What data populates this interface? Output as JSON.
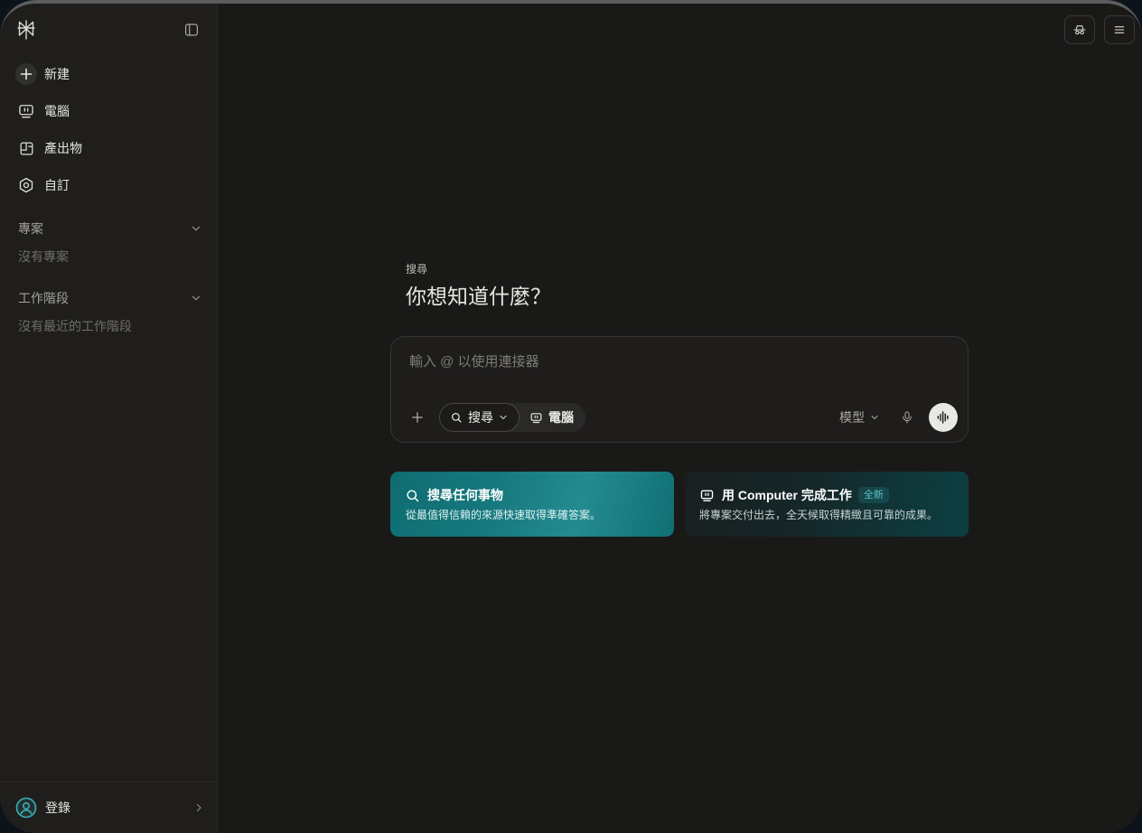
{
  "colors": {
    "page_background": "#0c131b",
    "sidebar_background": "#1f1e1c",
    "main_background": "#191918",
    "text_primary": "#e8e7e4",
    "text_muted": "#6f6d69",
    "accent_teal": "#15787d",
    "badge_text": "#5cc4c8",
    "avatar_ring": "#3aa3a8"
  },
  "sidebar": {
    "logo_icon": "perplexity-logo-icon",
    "toggle_icon": "sidebar-toggle-icon",
    "nav": [
      {
        "label": "新建",
        "icon": "plus-circle-icon"
      },
      {
        "label": "電腦",
        "icon": "computer-icon"
      },
      {
        "label": "產出物",
        "icon": "artifacts-icon"
      },
      {
        "label": "自訂",
        "icon": "customize-icon"
      }
    ],
    "sections": [
      {
        "title": "專案",
        "empty_text": "沒有專案",
        "expanded": true
      },
      {
        "title": "工作階段",
        "empty_text": "沒有最近的工作階段",
        "expanded": true
      }
    ],
    "footer": {
      "label": "登錄",
      "icon": "user-avatar-icon"
    }
  },
  "header": {
    "actions": [
      {
        "icon": "incognito-icon"
      },
      {
        "icon": "menu-icon"
      }
    ]
  },
  "main": {
    "eyebrow": "搜尋",
    "heading": "你想知道什麼？",
    "composer": {
      "value": "",
      "placeholder": "輸入 @ 以使用連接器",
      "modes": [
        {
          "label": "搜尋",
          "icon": "search-icon",
          "has_dropdown": true,
          "selected": true
        },
        {
          "label": "電腦",
          "icon": "computer-icon",
          "selected": false
        }
      ],
      "model_label": "模型"
    },
    "cards": [
      {
        "title": "搜尋任何事物",
        "icon": "search-icon",
        "subtitle": "從最值得信賴的來源快速取得準確答案。"
      },
      {
        "title": "用 Computer 完成工作",
        "icon": "computer-icon",
        "badge": "全新",
        "subtitle": "將專案交付出去，全天候取得精緻且可靠的成果。"
      }
    ]
  }
}
